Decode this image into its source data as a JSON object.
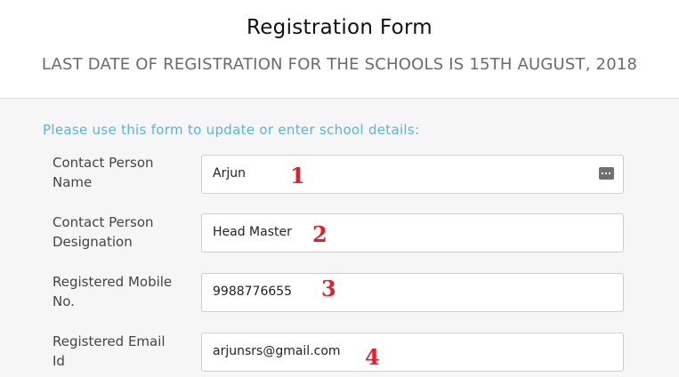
{
  "header": {
    "title": "Registration Form",
    "subtitle": "LAST DATE OF REGISTRATION FOR THE SCHOOLS IS 15TH AUGUST, 2018"
  },
  "form": {
    "intro": "Please use this form to update or enter school details:",
    "fields": [
      {
        "label_line1": "Contact Person",
        "label_line2": "Name",
        "value": "Arjun",
        "annotation": "1",
        "icon": "password-manager-key-icon"
      },
      {
        "label_line1": "Contact Person",
        "label_line2": "Designation",
        "value": "Head Master",
        "annotation": "2"
      },
      {
        "label_line1": "Registered Mobile",
        "label_line2": "No.",
        "value": "9988776655",
        "annotation": "3"
      },
      {
        "label_line1": "Registered Email",
        "label_line2": "Id",
        "value": "arjunsrs@gmail.com",
        "annotation": "4"
      }
    ]
  },
  "colors": {
    "intro_text": "#5bb3d9",
    "annotation": "#e0202a",
    "form_background": "#f6f6f6"
  }
}
